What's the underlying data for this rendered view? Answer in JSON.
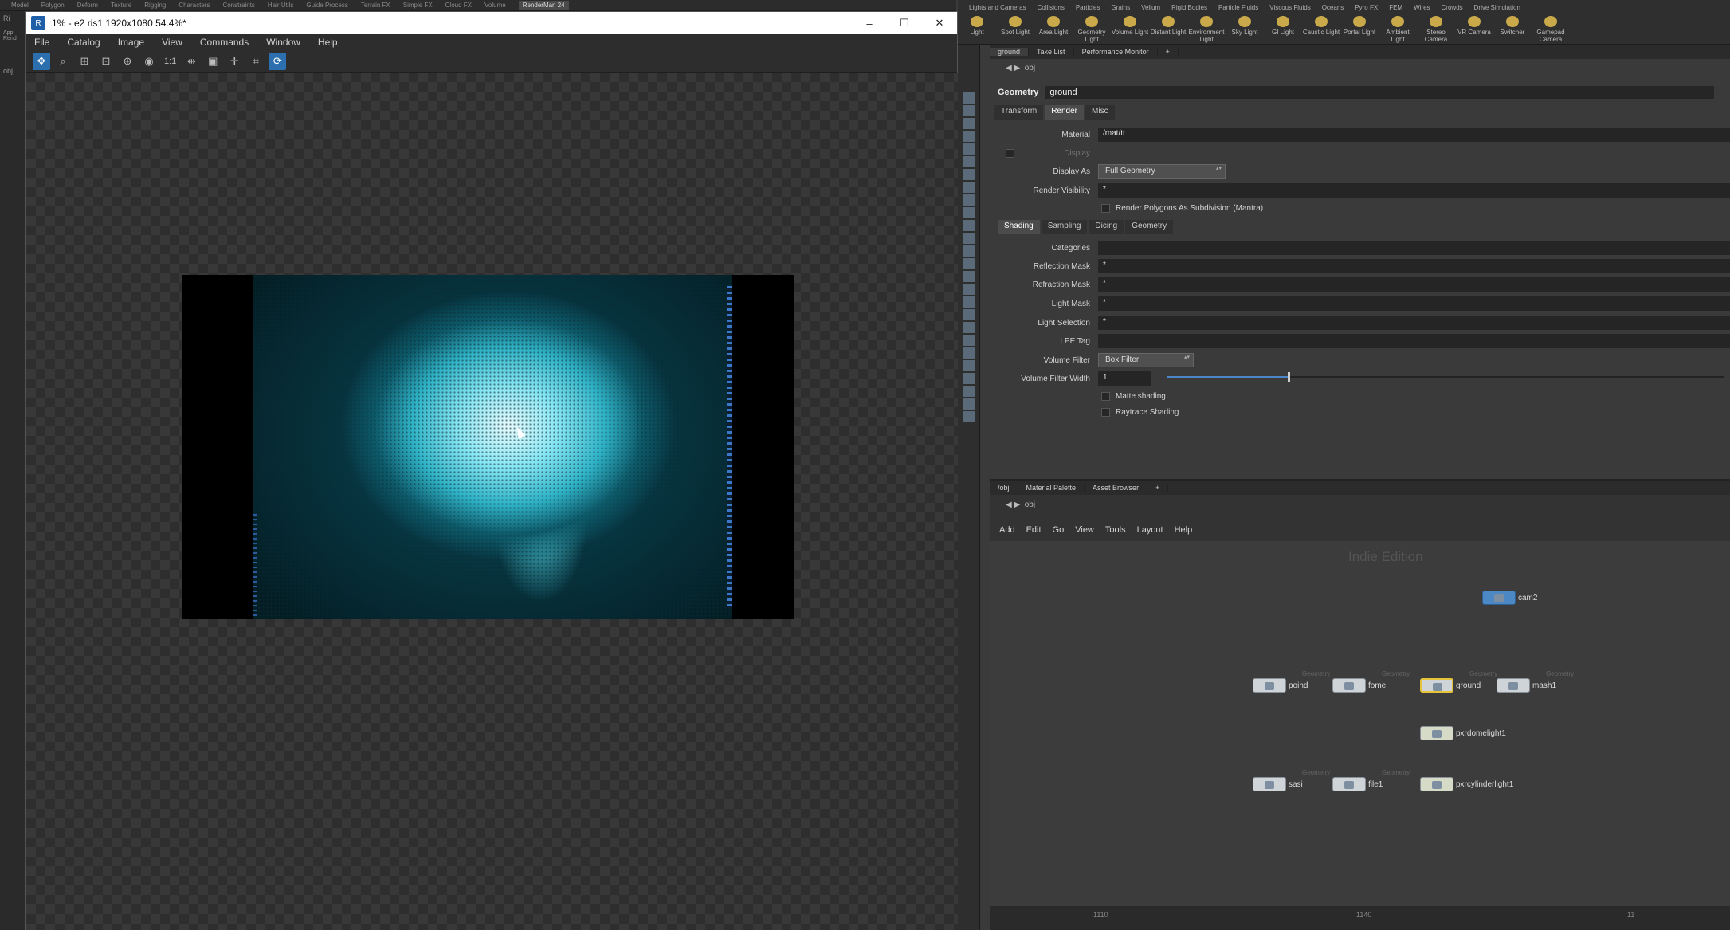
{
  "houdini_top_shelf_tabs": [
    "Model",
    "Polygon",
    "Deform",
    "Texture",
    "Rigging",
    "Characters",
    "Constraints",
    "Hair Utils",
    "Guide Process",
    "Terrain FX",
    "Simple FX",
    "Cloud FX",
    "Volume",
    "RenderMan 24"
  ],
  "houdini_top_shelf_active": "RenderMan 24",
  "left_strip": {
    "top_label": "Ri",
    "label2": "App Rend",
    "label3": "obj"
  },
  "window": {
    "title": "1% - e2 ris1 1920x1080 54.4%*",
    "icon_letter": "R",
    "min": "–",
    "max": "☐",
    "close": "✕"
  },
  "menu": [
    "File",
    "Catalog",
    "Image",
    "View",
    "Commands",
    "Window",
    "Help"
  ],
  "toolbar": {
    "one_to_one": "1:1"
  },
  "houdini": {
    "shelf_tabs": [
      "Lights and Cameras",
      "Collisions",
      "Particles",
      "Grains",
      "Vellum",
      "Rigid Bodies",
      "Particle Fluids",
      "Viscous Fluids",
      "Oceans",
      "Pyro FX",
      "FEM",
      "Wires",
      "Crowds",
      "Drive Simulation"
    ],
    "shelf_tools": [
      "Light",
      "Spot Light",
      "Area Light",
      "Geometry Light",
      "Volume Light",
      "Distant Light",
      "Environment Light",
      "Sky Light",
      "GI Light",
      "Caustic Light",
      "Portal Light",
      "Ambient Light",
      "Stereo Camera",
      "VR Camera",
      "Switcher",
      "Gamepad Camera"
    ],
    "param_tabs": [
      "ground",
      "Take List",
      "Performance Monitor",
      "+"
    ],
    "path": "obj",
    "node_type": "Geometry",
    "node_name": "ground",
    "sub_tabs": [
      "Transform",
      "Render",
      "Misc"
    ],
    "sub_tabs_active": "Render",
    "params": {
      "material_label": "Material",
      "material_value": "/mat/tt",
      "display_label": "Display",
      "display_as_label": "Display As",
      "display_as_value": "Full Geometry",
      "render_visibility_label": "Render Visibility",
      "render_visibility_value": "*",
      "render_polygons_label": "Render Polygons As Subdivision (Mantra)",
      "shading_tabs": [
        "Shading",
        "Sampling",
        "Dicing",
        "Geometry"
      ],
      "categories_label": "Categories",
      "categories_value": "",
      "reflection_mask_label": "Reflection Mask",
      "reflection_mask_value": "*",
      "refraction_mask_label": "Refraction Mask",
      "refraction_mask_value": "*",
      "light_mask_label": "Light Mask",
      "light_mask_value": "*",
      "light_selection_label": "Light Selection",
      "light_selection_value": "*",
      "lpe_tag_label": "LPE Tag",
      "lpe_tag_value": "",
      "volume_filter_label": "Volume Filter",
      "volume_filter_value": "Box Filter",
      "volume_filter_width_label": "Volume Filter Width",
      "volume_filter_width_value": "1",
      "volume_filter_width_level": 0.22,
      "matte_shading_label": "Matte shading",
      "raytrace_shading_label": "Raytrace Shading"
    },
    "net_tabs": [
      "/obj",
      "Material Palette",
      "Asset Browser",
      "+"
    ],
    "net_path": "obj",
    "net_menu": [
      "Add",
      "Edit",
      "Go",
      "View",
      "Tools",
      "Layout",
      "Help"
    ],
    "watermark": "Indie Edition",
    "nodes": {
      "cam2": "cam2",
      "poind": "poind",
      "fome": "fome",
      "ground": "ground",
      "mash1": "mash1",
      "pxrdomelight1": "pxrdomelight1",
      "sasi": "sasi",
      "file1": "file1",
      "pxrcylinderlight1": "pxrcylinderlight1",
      "geometry_type": "Geometry"
    },
    "ruler": [
      "1110",
      "1140",
      "11"
    ]
  }
}
